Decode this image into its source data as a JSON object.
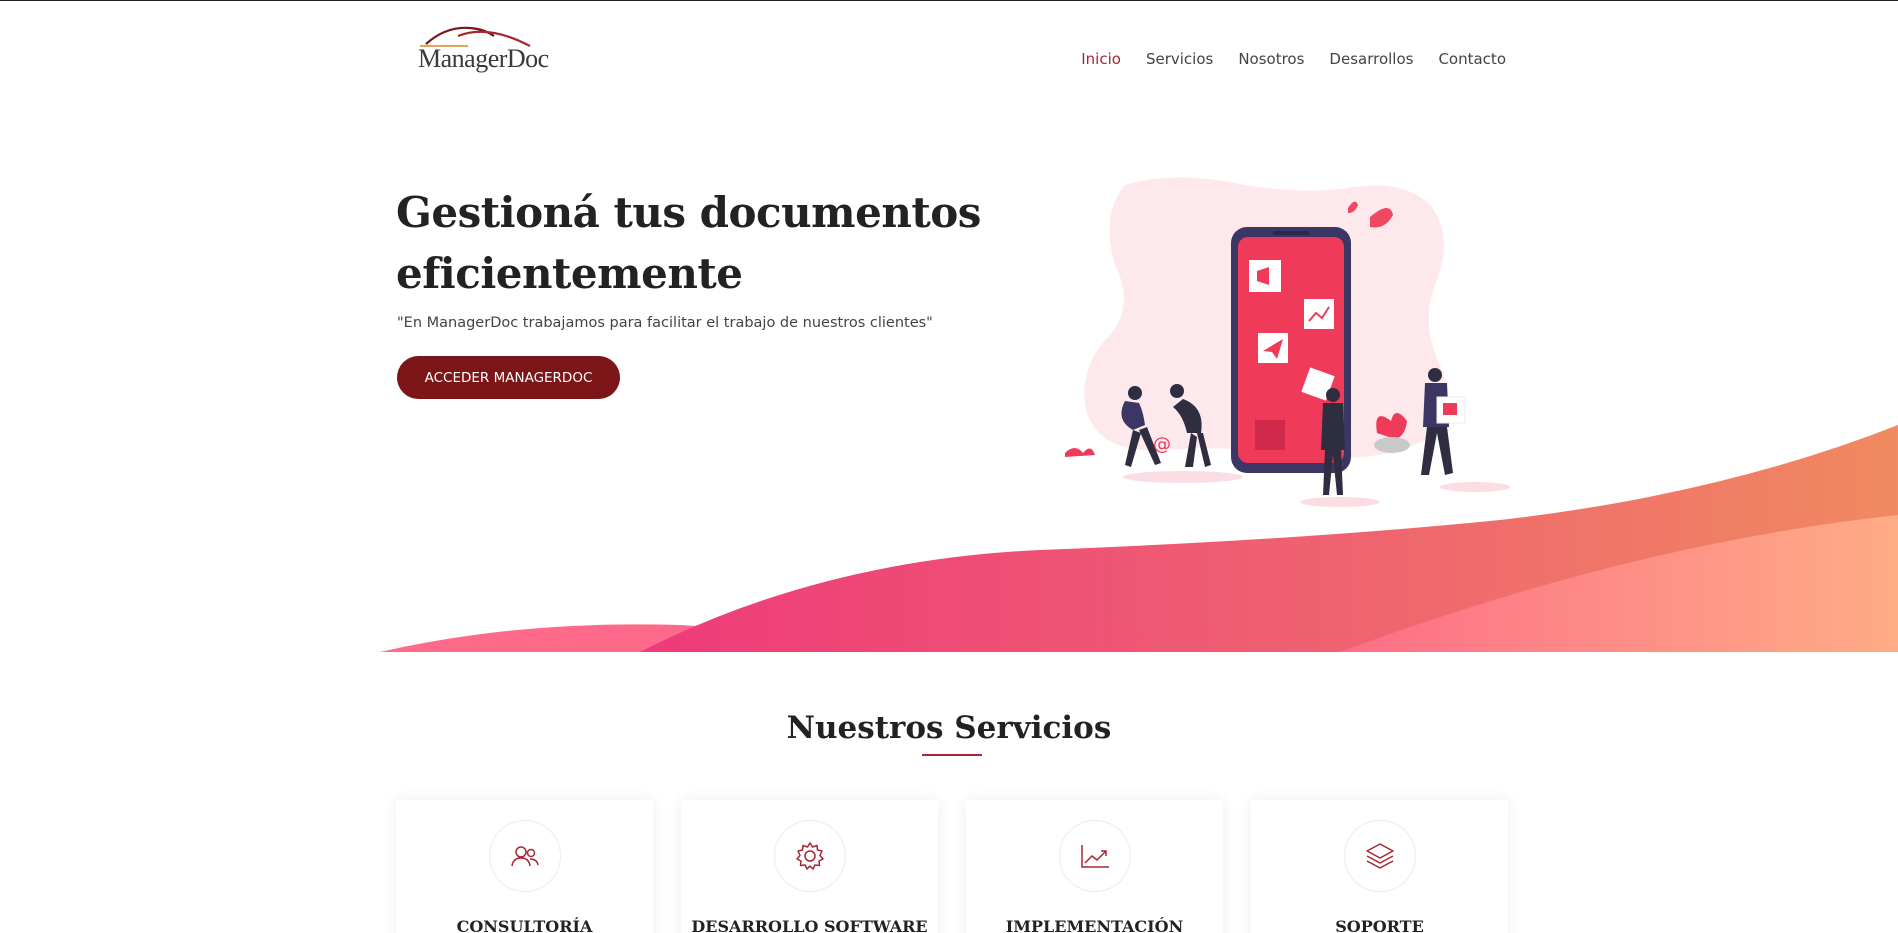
{
  "header": {
    "logo_text": "ManagerDoc",
    "nav": [
      {
        "label": "Inicio",
        "active": true
      },
      {
        "label": "Servicios",
        "active": false
      },
      {
        "label": "Nosotros",
        "active": false
      },
      {
        "label": "Desarrollos",
        "active": false
      },
      {
        "label": "Contacto",
        "active": false
      }
    ]
  },
  "hero": {
    "title_line1": "Gestioná tus documentos",
    "title_line2": "eficientemente",
    "subtitle": "\"En ManagerDoc trabajamos para facilitar el trabajo de nuestros clientes\"",
    "cta_label": "ACCEDER MANAGERDOC"
  },
  "services": {
    "title": "Nuestros Servicios",
    "cards": [
      {
        "title": "CONSULTORÍA",
        "icon": "users-icon"
      },
      {
        "title": "DESARROLLO SOFTWARE",
        "icon": "gear-icon"
      },
      {
        "title": "IMPLEMENTACIÓN",
        "icon": "chart-line-icon"
      },
      {
        "title": "SOPORTE",
        "icon": "layers-icon"
      }
    ]
  },
  "colors": {
    "accent": "#a7262f",
    "button": "#7b1518",
    "wave_pink": "#ee3a7a",
    "wave_orange": "#f4906a"
  }
}
